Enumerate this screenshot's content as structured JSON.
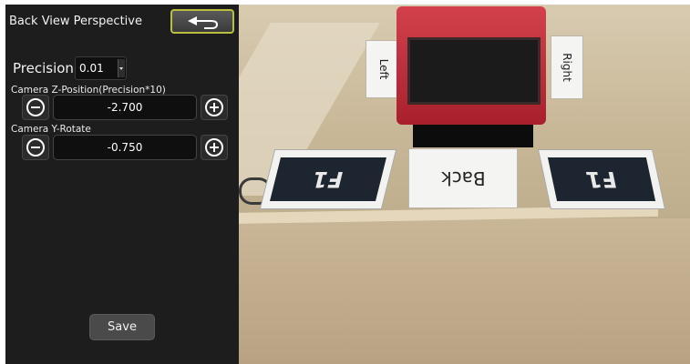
{
  "panel": {
    "title": "Back View Perspective",
    "back_icon": "back-arrow-icon",
    "precision": {
      "label": "Precision:",
      "value": "0.01"
    },
    "fields": [
      {
        "label": "Camera  Z-Position(Precision*10)",
        "value": "-2.700",
        "minus_icon": "minus-circle-icon",
        "plus_icon": "plus-circle-icon"
      },
      {
        "label": "Camera Y-Rotate",
        "value": "-0.750",
        "minus_icon": "minus-circle-icon",
        "plus_icon": "plus-circle-icon"
      }
    ],
    "save_label": "Save"
  },
  "feed": {
    "labels": {
      "left": "Left",
      "right": "Right",
      "back": "Back"
    },
    "markers": [
      "F1",
      "F1"
    ]
  }
}
